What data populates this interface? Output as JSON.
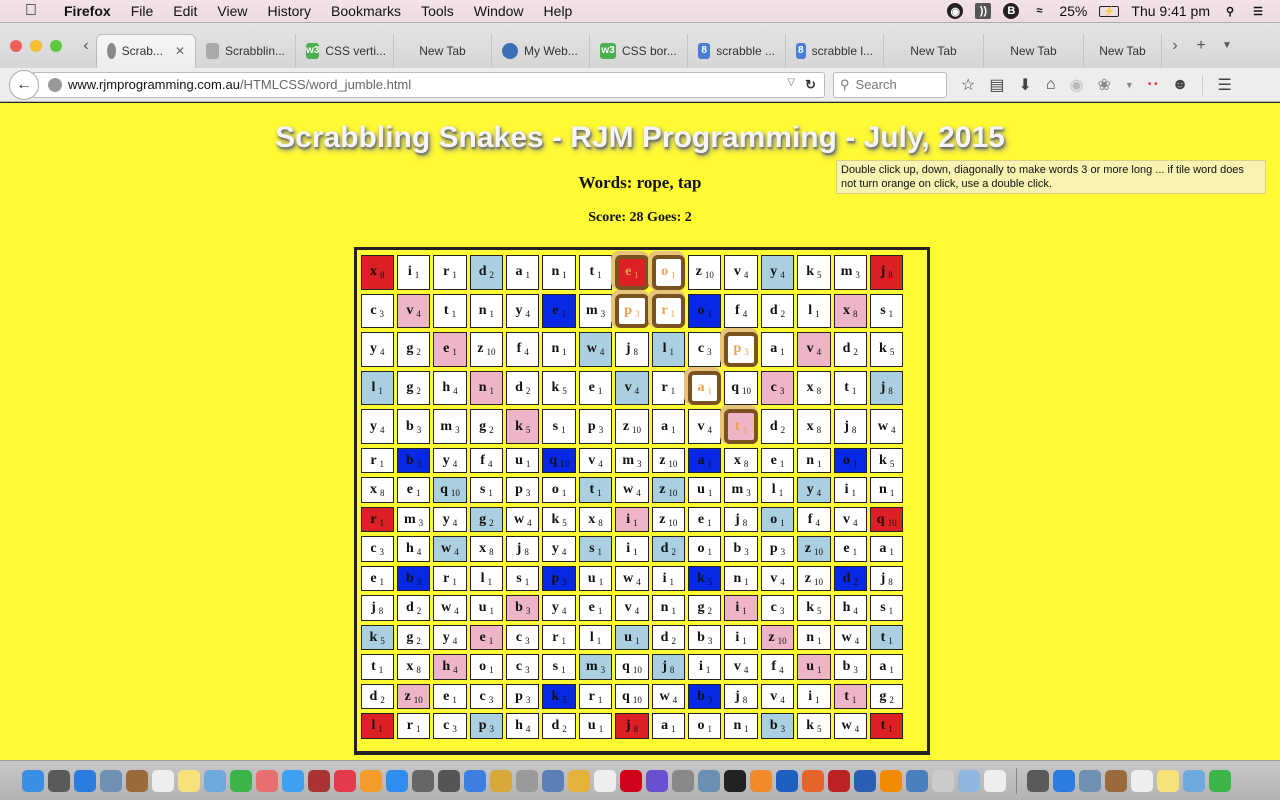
{
  "menubar": {
    "app": "Firefox",
    "items": [
      "File",
      "Edit",
      "View",
      "History",
      "Bookmarks",
      "Tools",
      "Window",
      "Help"
    ],
    "battery": "25%",
    "clock": "Thu 9:41 pm"
  },
  "tabs": [
    {
      "label": "Scrab...",
      "icon": "globe",
      "active": true
    },
    {
      "label": "Scrabblin...",
      "icon": "scr"
    },
    {
      "label": "CSS verti...",
      "icon": "w3"
    },
    {
      "label": "New Tab",
      "icon": ""
    },
    {
      "label": "My Web...",
      "icon": "blue"
    },
    {
      "label": "CSS bor...",
      "icon": "w3"
    },
    {
      "label": "scrabble ...",
      "icon": "goog"
    },
    {
      "label": "scrabble l...",
      "icon": "goog"
    },
    {
      "label": "New Tab",
      "icon": ""
    },
    {
      "label": "New Tab",
      "icon": ""
    },
    {
      "label": "New Tab",
      "icon": ""
    }
  ],
  "navbar": {
    "url_host": "www.rjmprogramming.com.au",
    "url_path": "/HTMLCSS/word_jumble.html",
    "search_placeholder": "Search"
  },
  "page": {
    "title": "Scrabbling Snakes - RJM Programming - July, 2015",
    "words": "Words: rope, tap",
    "score": "Score: 28 Goes: 2",
    "tooltip": "Double click up, down, diagonally to make words 3 or more long ... if tile word does not turn orange on click, use a double click."
  },
  "colors": {
    "page_bg": "#fffa33",
    "red": "#dd1f26",
    "blue": "#0729e6",
    "light_blue": "#a9cfe0",
    "pink": "#edb5c6",
    "selected_text": "#e8a04c"
  },
  "board": [
    [
      [
        "x",
        8,
        "red"
      ],
      [
        "i",
        1,
        ""
      ],
      [
        "r",
        1,
        ""
      ],
      [
        "d",
        2,
        "lblue"
      ],
      [
        "a",
        1,
        ""
      ],
      [
        "n",
        1,
        ""
      ],
      [
        "t",
        1,
        ""
      ],
      [
        "e",
        1,
        "red sel"
      ],
      [
        "o",
        1,
        "sel"
      ],
      [
        "z",
        10,
        ""
      ],
      [
        "v",
        4,
        ""
      ],
      [
        "y",
        4,
        "lblue"
      ],
      [
        "k",
        5,
        ""
      ],
      [
        "m",
        3,
        ""
      ],
      [
        "j",
        8,
        "red"
      ]
    ],
    [
      [
        "c",
        3,
        ""
      ],
      [
        "v",
        4,
        "pink"
      ],
      [
        "t",
        1,
        ""
      ],
      [
        "n",
        1,
        ""
      ],
      [
        "y",
        4,
        ""
      ],
      [
        "e",
        1,
        "blue"
      ],
      [
        "m",
        3,
        ""
      ],
      [
        "p",
        3,
        "sel"
      ],
      [
        "r",
        1,
        "sel"
      ],
      [
        "o",
        1,
        "blue"
      ],
      [
        "f",
        4,
        ""
      ],
      [
        "d",
        2,
        ""
      ],
      [
        "l",
        1,
        ""
      ],
      [
        "x",
        8,
        "pink"
      ],
      [
        "s",
        1,
        ""
      ]
    ],
    [
      [
        "y",
        4,
        ""
      ],
      [
        "g",
        2,
        ""
      ],
      [
        "e",
        1,
        "pink"
      ],
      [
        "z",
        10,
        ""
      ],
      [
        "f",
        4,
        ""
      ],
      [
        "n",
        1,
        ""
      ],
      [
        "w",
        4,
        "lblue"
      ],
      [
        "j",
        8,
        ""
      ],
      [
        "l",
        1,
        "lblue"
      ],
      [
        "c",
        3,
        ""
      ],
      [
        "p",
        3,
        "sel"
      ],
      [
        "a",
        1,
        ""
      ],
      [
        "v",
        4,
        "pink"
      ],
      [
        "d",
        2,
        ""
      ],
      [
        "k",
        5,
        ""
      ]
    ],
    [
      [
        "l",
        1,
        "lblue"
      ],
      [
        "g",
        2,
        ""
      ],
      [
        "h",
        4,
        ""
      ],
      [
        "n",
        1,
        "pink"
      ],
      [
        "d",
        2,
        ""
      ],
      [
        "k",
        5,
        ""
      ],
      [
        "e",
        1,
        ""
      ],
      [
        "v",
        4,
        "lblue"
      ],
      [
        "r",
        1,
        ""
      ],
      [
        "a",
        1,
        "sel"
      ],
      [
        "q",
        10,
        ""
      ],
      [
        "c",
        3,
        "pink"
      ],
      [
        "x",
        8,
        ""
      ],
      [
        "t",
        1,
        ""
      ],
      [
        "j",
        8,
        "lblue"
      ]
    ],
    [
      [
        "y",
        4,
        ""
      ],
      [
        "b",
        3,
        ""
      ],
      [
        "m",
        3,
        ""
      ],
      [
        "g",
        2,
        ""
      ],
      [
        "k",
        5,
        "pink"
      ],
      [
        "s",
        1,
        ""
      ],
      [
        "p",
        3,
        ""
      ],
      [
        "z",
        10,
        ""
      ],
      [
        "a",
        1,
        ""
      ],
      [
        "v",
        4,
        ""
      ],
      [
        "t",
        1,
        "pink sel"
      ],
      [
        "d",
        2,
        ""
      ],
      [
        "x",
        8,
        ""
      ],
      [
        "j",
        8,
        ""
      ],
      [
        "w",
        4,
        ""
      ]
    ],
    [
      [
        "r",
        1,
        ""
      ],
      [
        "b",
        3,
        "blue"
      ],
      [
        "y",
        4,
        ""
      ],
      [
        "f",
        4,
        ""
      ],
      [
        "u",
        1,
        ""
      ],
      [
        "q",
        10,
        "blue"
      ],
      [
        "v",
        4,
        ""
      ],
      [
        "m",
        3,
        ""
      ],
      [
        "z",
        10,
        ""
      ],
      [
        "a",
        1,
        "blue"
      ],
      [
        "x",
        8,
        ""
      ],
      [
        "e",
        1,
        ""
      ],
      [
        "n",
        1,
        ""
      ],
      [
        "o",
        1,
        "blue"
      ],
      [
        "k",
        5,
        ""
      ]
    ],
    [
      [
        "x",
        8,
        ""
      ],
      [
        "e",
        1,
        ""
      ],
      [
        "q",
        10,
        "lblue"
      ],
      [
        "s",
        1,
        ""
      ],
      [
        "p",
        3,
        ""
      ],
      [
        "o",
        1,
        ""
      ],
      [
        "t",
        1,
        "lblue"
      ],
      [
        "w",
        4,
        ""
      ],
      [
        "z",
        10,
        "lblue"
      ],
      [
        "u",
        1,
        ""
      ],
      [
        "m",
        3,
        ""
      ],
      [
        "l",
        1,
        ""
      ],
      [
        "y",
        4,
        "lblue"
      ],
      [
        "i",
        1,
        ""
      ],
      [
        "n",
        1,
        ""
      ]
    ],
    [
      [
        "r",
        1,
        "red"
      ],
      [
        "m",
        3,
        ""
      ],
      [
        "y",
        4,
        ""
      ],
      [
        "g",
        2,
        "lblue"
      ],
      [
        "w",
        4,
        ""
      ],
      [
        "k",
        5,
        ""
      ],
      [
        "x",
        8,
        ""
      ],
      [
        "i",
        1,
        "pink"
      ],
      [
        "z",
        10,
        ""
      ],
      [
        "e",
        1,
        ""
      ],
      [
        "j",
        8,
        ""
      ],
      [
        "o",
        1,
        "lblue"
      ],
      [
        "f",
        4,
        ""
      ],
      [
        "v",
        4,
        ""
      ],
      [
        "q",
        10,
        "red"
      ]
    ],
    [
      [
        "c",
        3,
        ""
      ],
      [
        "h",
        4,
        ""
      ],
      [
        "w",
        4,
        "lblue"
      ],
      [
        "x",
        8,
        ""
      ],
      [
        "j",
        8,
        ""
      ],
      [
        "y",
        4,
        ""
      ],
      [
        "s",
        1,
        "lblue"
      ],
      [
        "i",
        1,
        ""
      ],
      [
        "d",
        2,
        "lblue"
      ],
      [
        "o",
        1,
        ""
      ],
      [
        "b",
        3,
        ""
      ],
      [
        "p",
        3,
        ""
      ],
      [
        "z",
        10,
        "lblue"
      ],
      [
        "e",
        1,
        ""
      ],
      [
        "a",
        1,
        ""
      ]
    ],
    [
      [
        "e",
        1,
        ""
      ],
      [
        "b",
        3,
        "blue"
      ],
      [
        "r",
        1,
        ""
      ],
      [
        "l",
        1,
        ""
      ],
      [
        "s",
        1,
        ""
      ],
      [
        "p",
        3,
        "blue"
      ],
      [
        "u",
        1,
        ""
      ],
      [
        "w",
        4,
        ""
      ],
      [
        "i",
        1,
        ""
      ],
      [
        "k",
        5,
        "blue"
      ],
      [
        "n",
        1,
        ""
      ],
      [
        "v",
        4,
        ""
      ],
      [
        "z",
        10,
        ""
      ],
      [
        "d",
        2,
        "blue"
      ],
      [
        "j",
        8,
        ""
      ]
    ],
    [
      [
        "j",
        8,
        ""
      ],
      [
        "d",
        2,
        ""
      ],
      [
        "w",
        4,
        ""
      ],
      [
        "u",
        1,
        ""
      ],
      [
        "b",
        3,
        "pink"
      ],
      [
        "y",
        4,
        ""
      ],
      [
        "e",
        1,
        ""
      ],
      [
        "v",
        4,
        ""
      ],
      [
        "n",
        1,
        ""
      ],
      [
        "g",
        2,
        ""
      ],
      [
        "i",
        1,
        "pink"
      ],
      [
        "c",
        3,
        ""
      ],
      [
        "k",
        5,
        ""
      ],
      [
        "h",
        4,
        ""
      ],
      [
        "s",
        1,
        ""
      ]
    ],
    [
      [
        "k",
        5,
        "lblue"
      ],
      [
        "g",
        2,
        ""
      ],
      [
        "y",
        4,
        ""
      ],
      [
        "e",
        1,
        "pink"
      ],
      [
        "c",
        3,
        ""
      ],
      [
        "r",
        1,
        ""
      ],
      [
        "l",
        1,
        ""
      ],
      [
        "u",
        1,
        "lblue"
      ],
      [
        "d",
        2,
        ""
      ],
      [
        "b",
        3,
        ""
      ],
      [
        "i",
        1,
        ""
      ],
      [
        "z",
        10,
        "pink"
      ],
      [
        "n",
        1,
        ""
      ],
      [
        "w",
        4,
        ""
      ],
      [
        "t",
        1,
        "lblue"
      ]
    ],
    [
      [
        "t",
        1,
        ""
      ],
      [
        "x",
        8,
        ""
      ],
      [
        "h",
        4,
        "pink"
      ],
      [
        "o",
        1,
        ""
      ],
      [
        "c",
        3,
        ""
      ],
      [
        "s",
        1,
        ""
      ],
      [
        "m",
        3,
        "lblue"
      ],
      [
        "q",
        10,
        ""
      ],
      [
        "j",
        8,
        "lblue"
      ],
      [
        "i",
        1,
        ""
      ],
      [
        "v",
        4,
        ""
      ],
      [
        "f",
        4,
        ""
      ],
      [
        "u",
        1,
        "pink"
      ],
      [
        "b",
        3,
        ""
      ],
      [
        "a",
        1,
        ""
      ]
    ],
    [
      [
        "d",
        2,
        ""
      ],
      [
        "z",
        10,
        "pink"
      ],
      [
        "e",
        1,
        ""
      ],
      [
        "c",
        3,
        ""
      ],
      [
        "p",
        3,
        ""
      ],
      [
        "k",
        5,
        "blue"
      ],
      [
        "r",
        1,
        ""
      ],
      [
        "q",
        10,
        ""
      ],
      [
        "w",
        4,
        ""
      ],
      [
        "b",
        3,
        "blue"
      ],
      [
        "j",
        8,
        ""
      ],
      [
        "v",
        4,
        ""
      ],
      [
        "i",
        1,
        ""
      ],
      [
        "t",
        1,
        "pink"
      ],
      [
        "g",
        2,
        ""
      ]
    ],
    [
      [
        "l",
        1,
        "red"
      ],
      [
        "r",
        1,
        ""
      ],
      [
        "c",
        3,
        ""
      ],
      [
        "p",
        3,
        "lblue"
      ],
      [
        "h",
        4,
        ""
      ],
      [
        "d",
        2,
        ""
      ],
      [
        "u",
        1,
        ""
      ],
      [
        "j",
        8,
        "red"
      ],
      [
        "a",
        1,
        ""
      ],
      [
        "o",
        1,
        ""
      ],
      [
        "n",
        1,
        ""
      ],
      [
        "b",
        3,
        "lblue"
      ],
      [
        "k",
        5,
        ""
      ],
      [
        "w",
        4,
        ""
      ],
      [
        "t",
        1,
        "red"
      ]
    ]
  ],
  "dock": [
    "finder",
    "launchpad",
    "safari",
    "preview",
    "contacts",
    "calendar",
    "notes",
    "photo-booth",
    "facetime",
    "photos",
    "messages",
    "photo-collage",
    "itunes",
    "ibooks",
    "app-store",
    "system-preferences",
    "gimp",
    "xcode",
    "filezilla-like",
    "disk-utility",
    "pencil",
    "chrome",
    "document",
    "opera",
    "imovie",
    "scissors",
    "image-capture",
    "terminal",
    "avast",
    "bbedit",
    "firefox",
    "filezilla",
    "quicktime",
    "vlc",
    "display",
    "help",
    "cube",
    "textedit",
    "sep",
    "doc",
    "window1",
    "window2",
    "window3",
    "window4",
    "window5",
    "window6",
    "trash"
  ]
}
